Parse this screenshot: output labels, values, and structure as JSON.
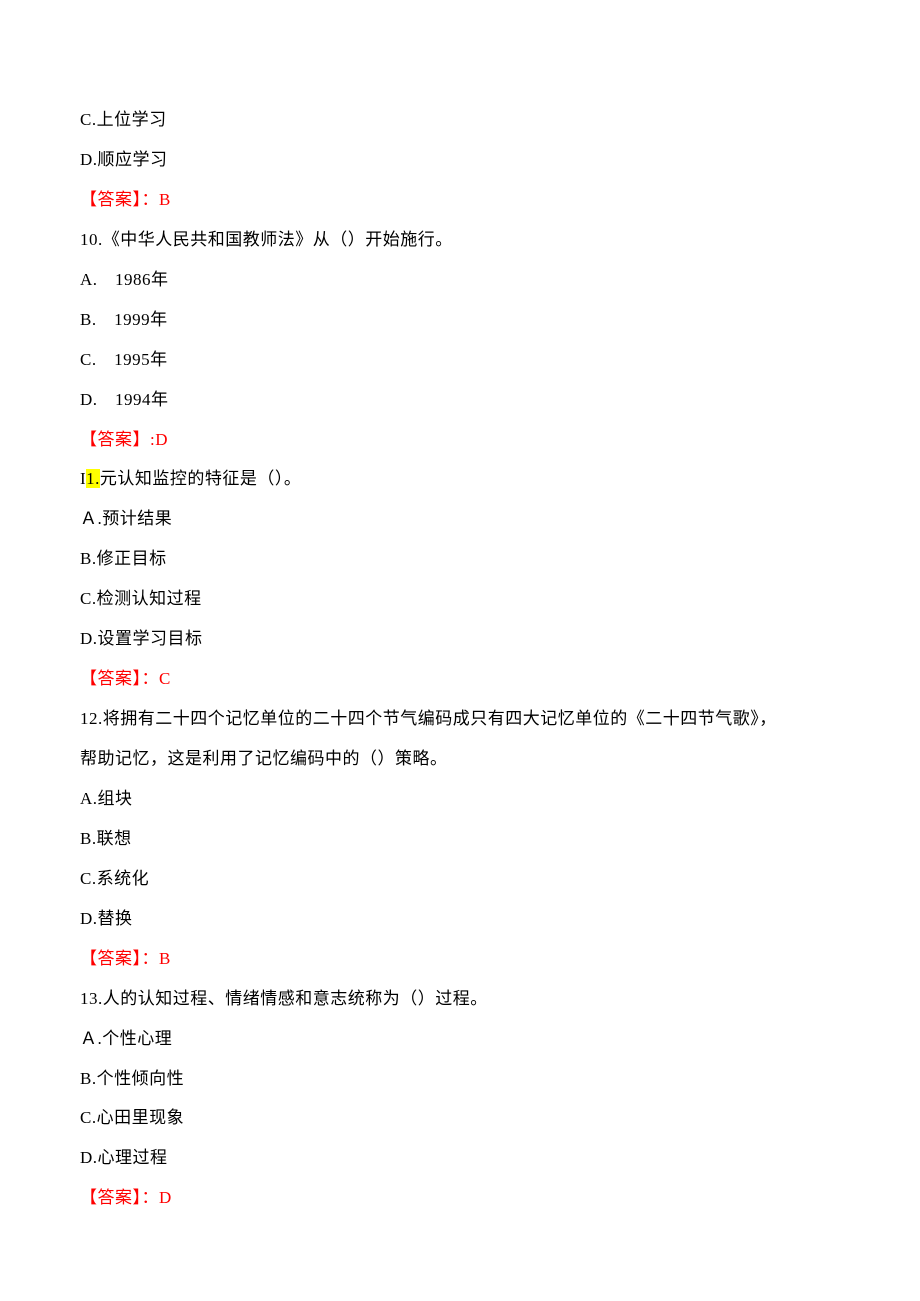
{
  "q9": {
    "optionC": "C.上位学习",
    "optionD": "D.顺应学习",
    "answerLabel": "【答案】：B"
  },
  "q10": {
    "stem": "10.《中华人民共和国教师法》从（）开始施行。",
    "optionA": "A.　1986年",
    "optionB": "B.　1999年",
    "optionC": "C.　1995年",
    "optionD": "D.　1994年",
    "answerLabel": "【答案】:D"
  },
  "q11": {
    "stemPrefix": "I",
    "stemHighlight": "1.",
    "stemSuffix": "元认知监控的特征是（）。",
    "optionA": "Ａ.预计结果",
    "optionB": "B.修正目标",
    "optionC": "C.检测认知过程",
    "optionD": "D.设置学习目标",
    "answerLabel": "【答案】：C"
  },
  "q12": {
    "stemLine1": "12.将拥有二十四个记忆单位的二十四个节气编码成只有四大记忆单位的《二十四节气歌》，",
    "stemLine2": "帮助记忆，这是利用了记忆编码中的（）策略。",
    "optionA": "A.组块",
    "optionB": "B.联想",
    "optionC": "C.系统化",
    "optionD": "D.替换",
    "answerLabel": "【答案】：B"
  },
  "q13": {
    "stem": "13.人的认知过程、情绪情感和意志统称为（）过程。",
    "optionA": "Ａ.个性心理",
    "optionB": "B.个性倾向性",
    "optionC": "C.心田里现象",
    "optionD": "D.心理过程",
    "answerLabel": "【答案】：D"
  }
}
